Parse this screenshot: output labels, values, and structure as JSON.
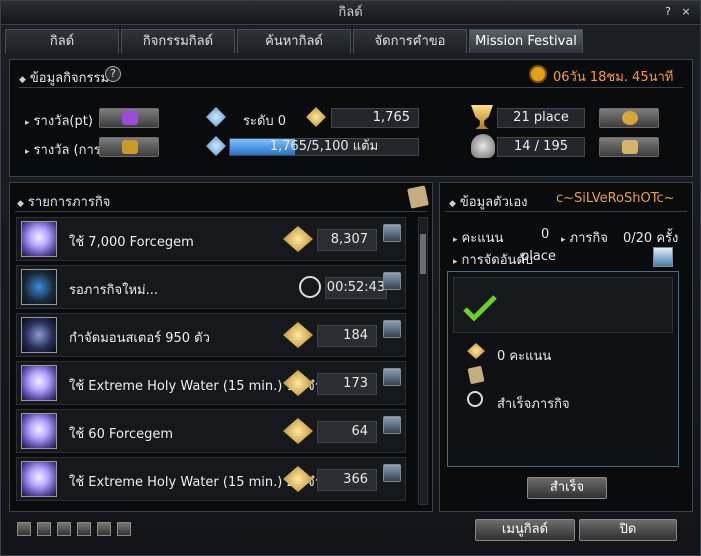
{
  "window": {
    "title": "กิลด์",
    "help": "?",
    "close": "×"
  },
  "tabs": [
    {
      "label": "กิลด์"
    },
    {
      "label": "กิจกรรมกิลด์"
    },
    {
      "label": "ค้นหากิลด์"
    },
    {
      "label": "จัดการคำขอ"
    },
    {
      "label": "Mission Festival"
    }
  ],
  "info": {
    "header": "ข้อมูลกิจกรรม",
    "timer": "06วัน 18ชม. 45นาที",
    "reward_pt_label": "รางวัล(pt)",
    "reward_rank_label": "รางวัล (การจัดอันดับ)",
    "level": "ระดับ 0",
    "points": "1,765",
    "progress_text": "1,765/5,100 แต้ม",
    "progress_fraction": 0.346,
    "place": "21 place",
    "members": "14 / 195"
  },
  "missions": {
    "header": "รายการภารกิจ",
    "items": [
      {
        "text": "ใช้ 7,000 Forcegem",
        "value": "8,307"
      },
      {
        "text": "รอภารกิจใหม่...",
        "value": "00:52:43"
      },
      {
        "text": "กำจัดมอนสเตอร์ 950 ตัว",
        "value": "184"
      },
      {
        "text": "ใช้ Extreme Holy Water (15 min.) 14 จำนวน",
        "value": "173"
      },
      {
        "text": "ใช้ 60 Forcegem",
        "value": "64"
      },
      {
        "text": "ใช้ Extreme Holy Water (15 min.) 22 จำนวน",
        "value": "366"
      }
    ]
  },
  "personal": {
    "header": "ข้อมูลตัวเอง",
    "name": "c~SiLVeRoShOTc~",
    "score_label": "คะแนน",
    "score_value": "0",
    "mission_label": "ภารกิจ",
    "mission_value": "0/20 ครั้ง",
    "rank_label": "การจัดอันดับ",
    "rank_overlap": "place",
    "points_text": "0 คะแนน",
    "complete_text": "สำเร็จภารกิจ",
    "done_button": "สำเร็จ"
  },
  "footer": {
    "guild_menu": "เมนูกิลด์",
    "close": "ปิด"
  },
  "colors": {
    "timer": "#ff9a2e",
    "name": "#e8a040",
    "progress": "#3a8ee0"
  }
}
